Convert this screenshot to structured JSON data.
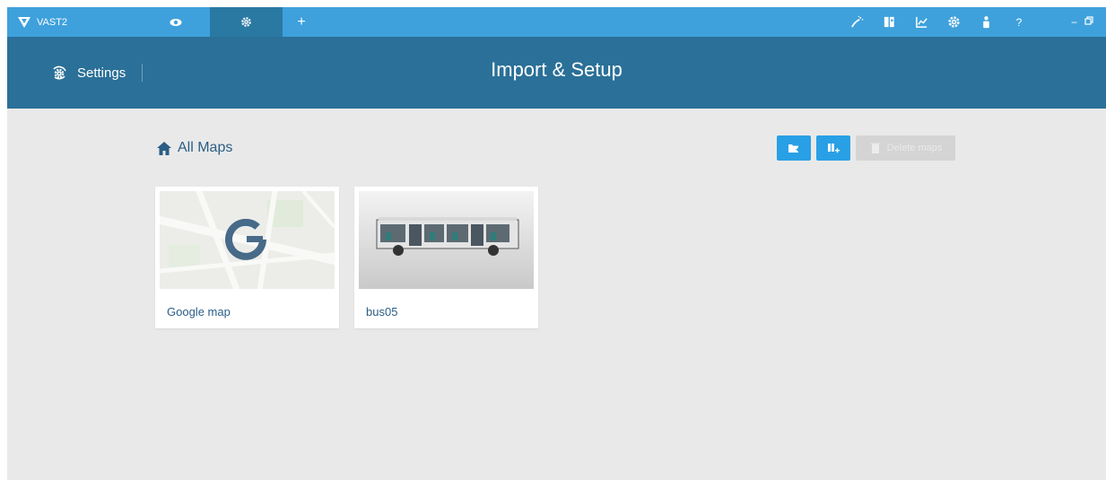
{
  "app": {
    "name": "VAST2"
  },
  "tabs": {
    "add_label": "+"
  },
  "toolbar": {
    "icons": [
      "wand-icon",
      "map-book-icon",
      "chart-icon",
      "gear-icon",
      "user-icon"
    ],
    "help_label": "?",
    "minimize_label": "−"
  },
  "header": {
    "section_label": "Settings",
    "title": "Import & Setup"
  },
  "content": {
    "breadcrumb_label": "All Maps",
    "delete_label": "Delete maps",
    "maps": [
      {
        "name": "Google map"
      },
      {
        "name": "bus05"
      }
    ]
  },
  "colors": {
    "topbar": "#3ea1dc",
    "active_tab": "#2a79a3",
    "header": "#2b7098",
    "accent_button": "#29a0e6",
    "link_text": "#2b5d85",
    "background": "#e9e9e9"
  }
}
